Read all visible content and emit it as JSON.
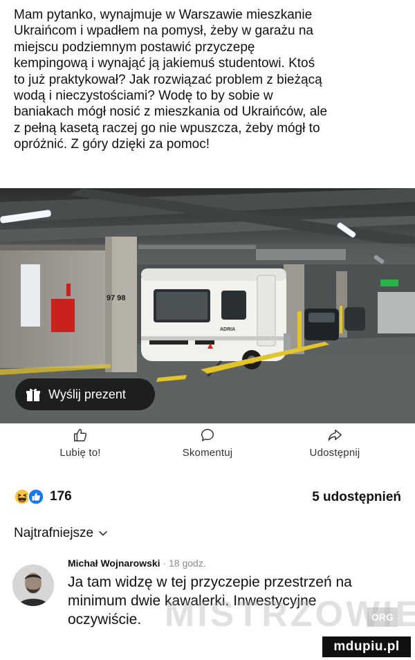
{
  "post": {
    "lines": [
      "Mam pytanko, wynajmuje w Warszawie mieszkanie",
      "Ukraińcom i wpadłem na pomysł, żeby w garażu na",
      "miejscu podziemnym postawić przyczepę",
      "kempingową i wynająć ją jakiemuś studentowi. Ktoś",
      "to już praktykował? Jak rozwiązać problem z bieżącą",
      "wodą i nieczystościami? Wodę to by sobie w",
      "baniakach mógł nosić z mieszkania od Ukraińców, ale",
      "z pełną kasetą raczej go nie wpuszcza, żeby mógł to",
      "opróżnić. Z góry dzięki za pomoc!"
    ]
  },
  "photo": {
    "parking_numbers": "97 98",
    "caravan_brand": "ADRIA"
  },
  "gift_button": {
    "label": "Wyślij prezent",
    "icon": "gift-icon"
  },
  "actions": {
    "like": {
      "label": "Lubię to!",
      "icon": "thumbs-up-icon"
    },
    "comment": {
      "label": "Skomentuj",
      "icon": "comment-bubble-icon"
    },
    "share": {
      "label": "Udostępnij",
      "icon": "share-arrow-icon"
    }
  },
  "stats": {
    "reaction_icons": [
      "haha-reaction-icon",
      "like-reaction-icon"
    ],
    "reaction_count": "176",
    "shares": "5 udostępnień"
  },
  "sort": {
    "label": "Najtrafniejsze"
  },
  "comment": {
    "author": "Michał Wojnarowski",
    "separator": "·",
    "time": "18 godz.",
    "lines": [
      "Ja tam widzę w tej przyczepie przestrzeń na",
      "minimum dwie kawalerki. Inwestycyjne",
      "oczywiście."
    ]
  },
  "watermarks": {
    "center": "MISTRZOWIE",
    "org": "ORG",
    "badge": "mdupiu.pl"
  },
  "colors": {
    "facebook_blue": "#1877f2",
    "haha_yellow": "#f7c548",
    "gift_button_bg": "#141414"
  }
}
